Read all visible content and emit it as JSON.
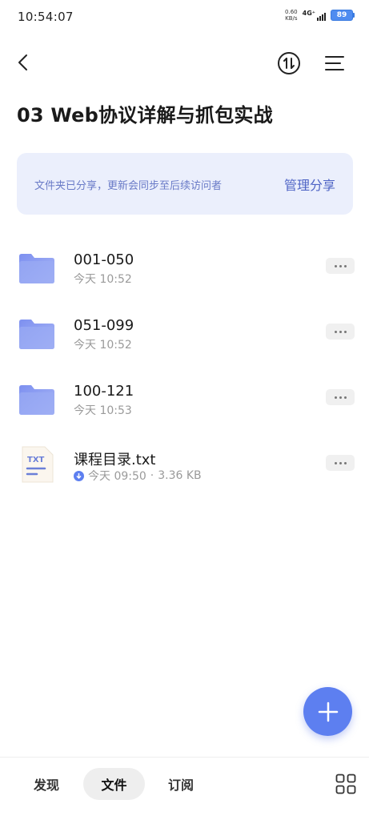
{
  "status": {
    "time": "10:54:07",
    "net_speed_value": "0.60",
    "net_speed_unit": "KB/s",
    "network": "4G⁺",
    "battery": "89"
  },
  "nav": {
    "back_icon": "back-arrow-icon",
    "sort_icon": "sort-icon",
    "menu_icon": "menu-icon"
  },
  "title": "03 Web协议详解与抓包实战",
  "share_banner": {
    "text": "文件夹已分享，更新会同步至后续访问者",
    "manage_label": "管理分享"
  },
  "files": [
    {
      "name": "001-050",
      "meta": "今天 10:52",
      "type": "folder"
    },
    {
      "name": "051-099",
      "meta": "今天 10:52",
      "type": "folder"
    },
    {
      "name": "100-121",
      "meta": "今天 10:53",
      "type": "folder"
    },
    {
      "name": "课程目录.txt",
      "meta": "今天 09:50",
      "size": "3.36 KB",
      "type": "txt",
      "icon_label": "TXT"
    }
  ],
  "bottom_nav": {
    "tabs": [
      "发现",
      "文件",
      "订阅"
    ],
    "active": "文件"
  },
  "colors": {
    "accent": "#5d7ff0",
    "banner_bg": "#ebeffc",
    "folder": "#8a9cf2"
  }
}
